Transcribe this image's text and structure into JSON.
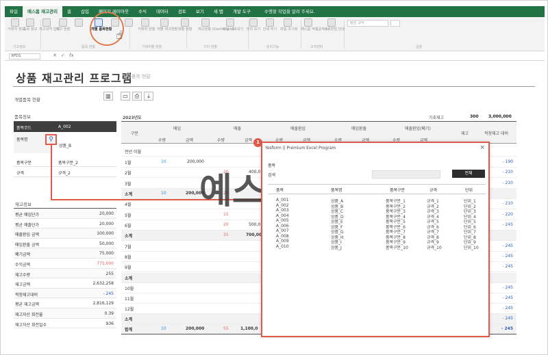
{
  "ribbon": {
    "tabs": [
      "파일",
      "예스폼 재고관리",
      "홈",
      "삽입",
      "페이지 레이아웃",
      "수식",
      "데이터",
      "검토",
      "보기",
      "새 탭",
      "개발 도구"
    ],
    "active_tab_index": 1,
    "search_label": "수행할 작업을 알려 주세요.",
    "buttons": [
      "거래처 정보",
      "품목 정보",
      "재고내역 입력",
      "재고 현황",
      "",
      "개별 품목현황",
      "",
      "",
      "거래처 현황",
      "개별 재고현황",
      "월별 현황",
      "재고현황 (Dashboard)",
      "파일 내보내기",
      "미리 보기",
      "인쇄 하기",
      "파일 초기화",
      "예스폼 엑셀공작소",
      "사용방법 안내"
    ],
    "groups": [
      "기초정보",
      "품목 현황",
      "거래처별 현황",
      "기타 현황",
      "관리기능",
      "고객센터",
      "글꼴"
    ],
    "font_name": "맑은 고딕"
  },
  "formula_bar": {
    "name_box": "XFD1",
    "fx": "fx"
  },
  "sheet": {
    "title": "상품 재고관리 프로그램",
    "subtitle": "개별품목 현황",
    "section_title": "개별품목 현황",
    "item_info_label": "품목정보",
    "item_code_label": "품목코드",
    "item_code": "A_002",
    "item_name_label": "품목명",
    "item_name": "상품_B",
    "category_label": "품목구분",
    "category": "품목구분_2",
    "spec_label": "규격",
    "spec": "규격_2",
    "stock_info_label": "재고정보",
    "stock_rows": [
      {
        "k": "평균 매입단가",
        "v": "20,000",
        "style": ""
      },
      {
        "k": "평균 매출단가",
        "v": "20,000",
        "style": ""
      },
      {
        "k": "매출환입 금액",
        "v": "100,000",
        "style": ""
      },
      {
        "k": "매입환출 금액",
        "v": "50,000",
        "style": ""
      },
      {
        "k": "폐기금액",
        "v": "75,000",
        "style": ""
      },
      {
        "k": "수익금액",
        "v": "775,000",
        "style": "red"
      },
      {
        "k": "재고수량",
        "v": "255",
        "style": ""
      },
      {
        "k": "재고금액",
        "v": "2,632,258",
        "style": ""
      },
      {
        "k": "적정재고대비",
        "v": "- 245",
        "style": "blue"
      },
      {
        "k": "평균 재고금액",
        "v": "2,816,129",
        "style": ""
      },
      {
        "k": "재고자산 회전율",
        "v": "0.39",
        "style": ""
      },
      {
        "k": "재고자산 회전일수",
        "v": "936",
        "style": ""
      }
    ],
    "year_label": "2023년도",
    "base_stock_label": "기초재고",
    "base_stock_qty": "300",
    "base_stock_amt": "3,000,000",
    "group_headers": [
      "매입",
      "매출",
      "매출환입",
      "매입환출",
      "매출환입(폐기)"
    ],
    "col_gubun": "구분",
    "col_qty": "수량",
    "col_amt": "금액",
    "col_stock": "재고",
    "col_ratio": "적정재고 대비",
    "months": [
      "전년 이월",
      "1월",
      "2월",
      "3월",
      "소계",
      "4월",
      "5월",
      "6월",
      "소계",
      "7월",
      "8월",
      "9월",
      "소계",
      "10월",
      "11월",
      "12월",
      "소계",
      "합계"
    ],
    "grid_values": {
      "jan_qty": "10",
      "jan_amt": "200,000",
      "feb_qty": "20",
      "feb_amt": "400,0",
      "q1_qty": "10",
      "q1_amt": "200,000",
      "q1_sq": "20",
      "may_qty": "15",
      "jun_qty": "20",
      "jun_amt": "500,0",
      "h1_qty": "35",
      "h1_amt": "700,00",
      "total_qty": "10",
      "total_amt": "200,000",
      "total_sq": "55",
      "total_samt": "1,100,0"
    },
    "ratio_values": [
      "- 190",
      "- 210",
      "- 210",
      "- 210",
      "- 220",
      "- 245",
      "- 245",
      "- 245",
      "- 245",
      "- 245",
      "- 245",
      "- 245",
      "- 245",
      "- 245"
    ]
  },
  "popup": {
    "badge": "1",
    "title": "Yesform  ||  Premium Excel Program",
    "close": "×",
    "search_label": "품목",
    "search_label2": "검색",
    "search_button": "전체",
    "headers": [
      "품목명",
      "품목구분",
      "규격",
      "단위"
    ],
    "code_header": "품목",
    "rows": [
      [
        "A_001",
        "상품_A",
        "품목구분_1",
        "규격_1",
        "단위_1"
      ],
      [
        "A_002",
        "상품_B",
        "품목구분_2",
        "규격_2",
        "단위_2"
      ],
      [
        "A_003",
        "상품_C",
        "품목구분_3",
        "규격_3",
        "단위_3"
      ],
      [
        "A_004",
        "상품_D",
        "품목구분_4",
        "규격_4",
        "단위_4"
      ],
      [
        "A_005",
        "상품_E",
        "품목구분_5",
        "규격_5",
        "단위_5"
      ],
      [
        "A_006",
        "상품_F",
        "품목구분_6",
        "규격_6",
        "단위_6"
      ],
      [
        "A_007",
        "상품_G",
        "품목구분_7",
        "규격_7",
        "단위_7"
      ],
      [
        "A_008",
        "상품_H",
        "품목구분_8",
        "규격_8",
        "단위_8"
      ],
      [
        "A_009",
        "상품_I",
        "품목구분_9",
        "규격_9",
        "단위_9"
      ],
      [
        "A_010",
        "상품_J",
        "품목구분_10",
        "규격_10",
        "단위_10"
      ]
    ]
  },
  "watermark": {
    "text": "예스폼"
  },
  "colors": {
    "excel_green": "#217346",
    "accent_red": "#e05a4a",
    "link_blue": "#2f5eb3"
  }
}
